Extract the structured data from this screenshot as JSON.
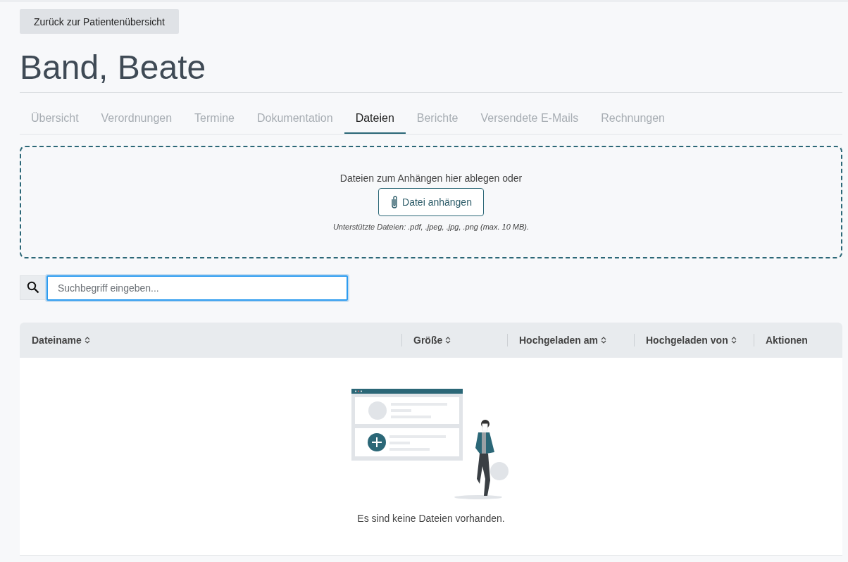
{
  "back_button": "Zurück zur Patientenübersicht",
  "patient_name": "Band, Beate",
  "tabs": [
    {
      "label": "Übersicht",
      "selected": false
    },
    {
      "label": "Verordnungen",
      "selected": false
    },
    {
      "label": "Termine",
      "selected": false
    },
    {
      "label": "Dokumentation",
      "selected": false
    },
    {
      "label": "Dateien",
      "selected": true
    },
    {
      "label": "Berichte",
      "selected": false
    },
    {
      "label": "Versendete E-Mails",
      "selected": false
    },
    {
      "label": "Rechnungen",
      "selected": false
    }
  ],
  "upload": {
    "prompt": "Dateien zum Anhängen hier ablegen oder",
    "button": "Datei anhängen",
    "hint": "Unterstützte Dateien: .pdf, .jpeg, .jpg, .png (max. 10 MB)."
  },
  "search": {
    "placeholder": "Suchbegriff eingeben..."
  },
  "table": {
    "columns": [
      {
        "label": "Dateiname",
        "sortable": true
      },
      {
        "label": "Größe",
        "sortable": true
      },
      {
        "label": "Hochgeladen am",
        "sortable": true
      },
      {
        "label": "Hochgeladen von",
        "sortable": true
      },
      {
        "label": "Aktionen",
        "sortable": false
      }
    ],
    "empty_message": "Es sind keine Dateien vorhanden."
  }
}
